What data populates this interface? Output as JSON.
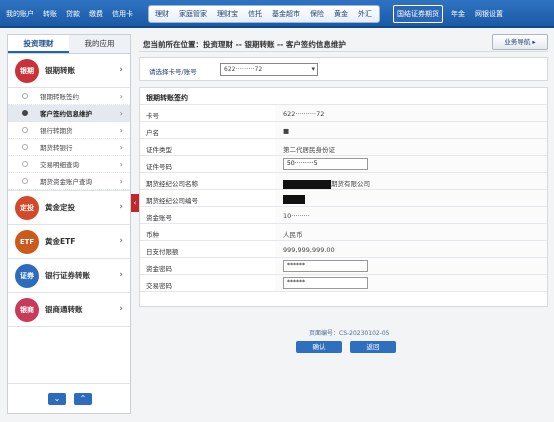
{
  "topnav": {
    "left_links": [
      "我的账户",
      "转账",
      "贷款",
      "缴费",
      "信用卡"
    ],
    "strip_links": [
      "理财",
      "家庭管家",
      "理财宝",
      "信托",
      "基金超市",
      "保险",
      "黄金",
      "外汇"
    ],
    "active_tab": "国结证券期货",
    "right_links": [
      "年金",
      "网银设置"
    ]
  },
  "sidebar": {
    "tabs": [
      "投资理财",
      "我的应用"
    ],
    "major": [
      {
        "label": "银期转账",
        "icon_text": "银期",
        "color": "#c8323a"
      },
      {
        "label": "黄金定投",
        "icon_text": "定投",
        "color": "#d24a2b"
      },
      {
        "label": "黄金ETF",
        "icon_text": "ETF",
        "color": "#cc5a1e"
      },
      {
        "label": "银行证券转账",
        "icon_text": "证券",
        "color": "#2d6bbd"
      },
      {
        "label": "银商通转账",
        "icon_text": "银商",
        "color": "#c83a5a"
      }
    ],
    "sub_items": [
      "银期转账签约",
      "客户签约信息维护",
      "银行转期货",
      "期货转银行",
      "交易明细查询",
      "期货资金账户查询"
    ],
    "scroll_down": "⌄",
    "scroll_up": "⌃"
  },
  "main": {
    "breadcrumb": "您当前所在位置：投资理财 -- 银期转账 -- 客户签约信息维护",
    "biz_nav": "业务导航 ▸",
    "selector_label": "请选择卡号/账号",
    "selector_value": "622··········72",
    "form_title": "银期转账签约",
    "rows": [
      {
        "key": "卡号",
        "value": "622··········72"
      },
      {
        "key": "户名",
        "value": "■"
      },
      {
        "key": "证件类型",
        "value": "第二代居民身份证"
      },
      {
        "key": "证件号码",
        "value": "50··········5"
      },
      {
        "key": "期货经纪公司名称",
        "value": "期货有限公司"
      },
      {
        "key": "期货经纪公司编号",
        "value": ""
      },
      {
        "key": "资金账号",
        "value": "10·········"
      },
      {
        "key": "币种",
        "value": "人民币"
      },
      {
        "key": "日支付限额",
        "value": "999,999,999.00"
      },
      {
        "key": "资金密码",
        "value": "******"
      },
      {
        "key": "交易密码",
        "value": "******"
      }
    ],
    "confirm": "确认",
    "back": "返回",
    "page_code": "页面编号：CS-20230102-05"
  }
}
